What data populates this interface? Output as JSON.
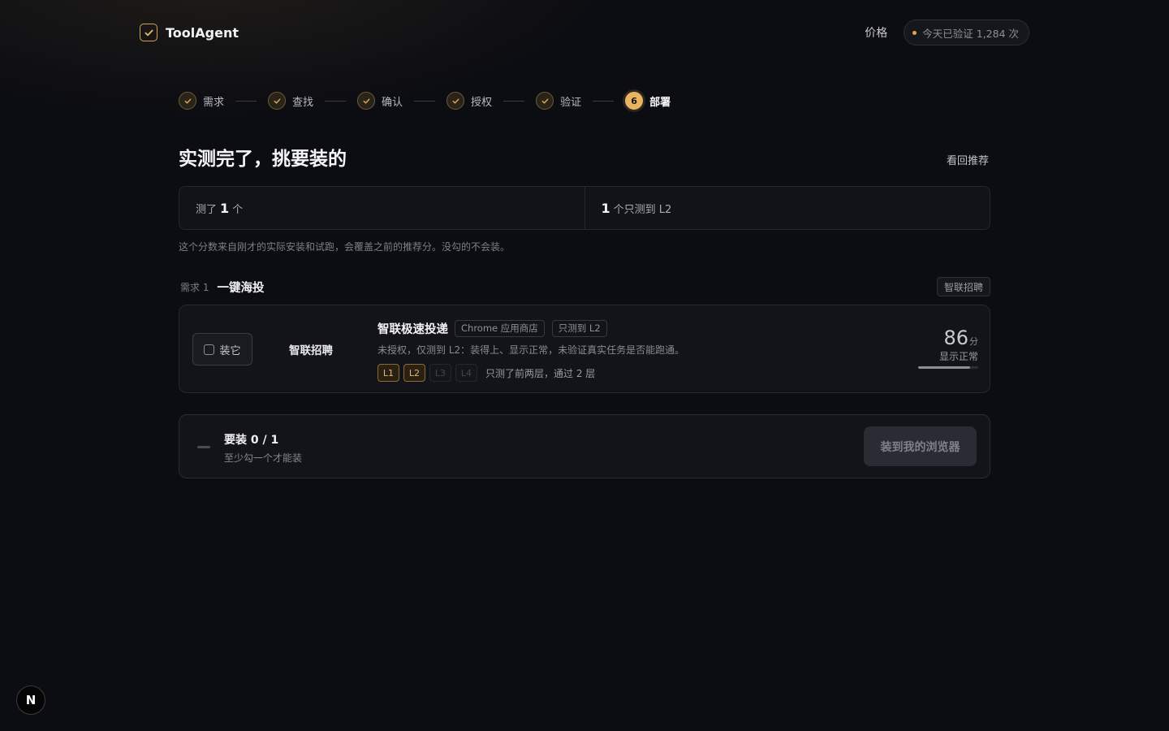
{
  "header": {
    "brand": "ToolAgent",
    "price_link": "价格",
    "verify_pill": "今天已验证 1,284 次"
  },
  "steps": [
    {
      "label": "需求",
      "done": true
    },
    {
      "label": "查找",
      "done": true
    },
    {
      "label": "确认",
      "done": true
    },
    {
      "label": "授权",
      "done": true
    },
    {
      "label": "验证",
      "done": true
    },
    {
      "label": "部署",
      "number": "6",
      "active": true
    }
  ],
  "main": {
    "title": "实测完了，挑要装的",
    "back_link": "看回推荐",
    "stats": {
      "tested_prefix": "测了",
      "tested_count": "1",
      "tested_suffix": "个",
      "l2_count": "1",
      "l2_suffix": "个只测到 L2"
    },
    "note": "这个分数来自刚才的实际安装和试跑，会覆盖之前的推荐分。没勾的不会装。"
  },
  "need": {
    "index_label": "需求 1",
    "name": "一键海投",
    "tag": "智联招聘"
  },
  "tool": {
    "install_label": "装它",
    "vendor": "智联招聘",
    "name": "智联极速投递",
    "tags": [
      "Chrome 应用商店",
      "只测到 L2"
    ],
    "description": "未授权，仅测到 L2：装得上、显示正常，未验证真实任务是否能跑通。",
    "levels": [
      {
        "label": "L1",
        "passed": true
      },
      {
        "label": "L2",
        "passed": true
      },
      {
        "label": "L3",
        "passed": false
      },
      {
        "label": "L4",
        "passed": false
      }
    ],
    "levels_note": "只测了前两层，通过 2 层",
    "score": "86",
    "score_unit": "分",
    "score_label": "显示正常",
    "score_fraction": 0.86
  },
  "deploy": {
    "title": "要装 0 / 1",
    "subtitle": "至少勾一个才能装",
    "button": "装到我的浏览器"
  },
  "badge": {
    "letter": "N"
  },
  "colors": {
    "accent": "#e8b461",
    "background": "#0c0d12"
  }
}
